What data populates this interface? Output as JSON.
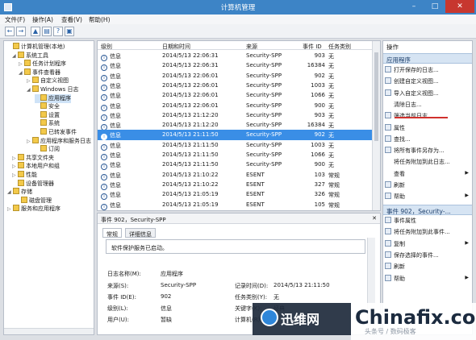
{
  "window": {
    "title": "计算机管理",
    "min_glyph": "–",
    "max_glyph": "□",
    "close_glyph": "✕"
  },
  "menu": [
    "文件(F)",
    "操作(A)",
    "查看(V)",
    "帮助(H)"
  ],
  "toolbar": [
    "←",
    "→",
    "▲",
    "▤",
    "?",
    "▣"
  ],
  "tree": [
    {
      "label": "计算机管理(本地)",
      "arrow": "",
      "icon": "computer-icon"
    },
    {
      "label": "系统工具",
      "arrow": "◢",
      "icon": "tools-icon"
    },
    {
      "label": "任务计划程序",
      "arrow": "▷",
      "icon": "clock-icon"
    },
    {
      "label": "事件查看器",
      "arrow": "◢",
      "icon": "event-viewer-icon"
    },
    {
      "label": "自定义视图",
      "arrow": "▷",
      "icon": "folder-icon"
    },
    {
      "label": "Windows 日志",
      "arrow": "◢",
      "icon": "folder-icon"
    },
    {
      "label": "应用程序",
      "arrow": "",
      "icon": "log-icon"
    },
    {
      "label": "安全",
      "arrow": "",
      "icon": "log-icon"
    },
    {
      "label": "设置",
      "arrow": "",
      "icon": "log-icon"
    },
    {
      "label": "系统",
      "arrow": "",
      "icon": "log-icon"
    },
    {
      "label": "已转发事件",
      "arrow": "",
      "icon": "log-icon"
    },
    {
      "label": "应用程序和服务日志",
      "arrow": "▷",
      "icon": "folder-icon"
    },
    {
      "label": "订阅",
      "arrow": "",
      "icon": "log-icon"
    },
    {
      "label": "共享文件夹",
      "arrow": "▷",
      "icon": "share-icon"
    },
    {
      "label": "本地用户和组",
      "arrow": "▷",
      "icon": "users-icon"
    },
    {
      "label": "性能",
      "arrow": "▷",
      "icon": "performance-icon"
    },
    {
      "label": "设备管理器",
      "arrow": "",
      "icon": "device-icon"
    },
    {
      "label": "存储",
      "arrow": "◢",
      "icon": "storage-icon"
    },
    {
      "label": "磁盘管理",
      "arrow": "",
      "icon": "disk-icon"
    },
    {
      "label": "服务和应用程序",
      "arrow": "▷",
      "icon": "services-icon"
    }
  ],
  "columns": [
    "级别",
    "日期和时间",
    "来源",
    "事件 ID",
    "任务类别"
  ],
  "events": [
    {
      "level": "信息",
      "datetime": "2014/5/13 22:06:31",
      "source": "Security-SPP",
      "id": "903",
      "category": "无"
    },
    {
      "level": "信息",
      "datetime": "2014/5/13 22:06:31",
      "source": "Security-SPP",
      "id": "16384",
      "category": "无"
    },
    {
      "level": "信息",
      "datetime": "2014/5/13 22:06:01",
      "source": "Security-SPP",
      "id": "902",
      "category": "无"
    },
    {
      "level": "信息",
      "datetime": "2014/5/13 22:06:01",
      "source": "Security-SPP",
      "id": "1003",
      "category": "无"
    },
    {
      "level": "信息",
      "datetime": "2014/5/13 22:06:01",
      "source": "Security-SPP",
      "id": "1066",
      "category": "无"
    },
    {
      "level": "信息",
      "datetime": "2014/5/13 22:06:01",
      "source": "Security-SPP",
      "id": "900",
      "category": "无"
    },
    {
      "level": "信息",
      "datetime": "2014/5/13 21:12:20",
      "source": "Security-SPP",
      "id": "903",
      "category": "无"
    },
    {
      "level": "信息",
      "datetime": "2014/5/13 21:12:20",
      "source": "Security-SPP",
      "id": "16384",
      "category": "无"
    },
    {
      "level": "信息",
      "datetime": "2014/5/13 21:11:50",
      "source": "Security-SPP",
      "id": "902",
      "category": "无"
    },
    {
      "level": "信息",
      "datetime": "2014/5/13 21:11:50",
      "source": "Security-SPP",
      "id": "1003",
      "category": "无"
    },
    {
      "level": "信息",
      "datetime": "2014/5/13 21:11:50",
      "source": "Security-SPP",
      "id": "1066",
      "category": "无"
    },
    {
      "level": "信息",
      "datetime": "2014/5/13 21:11:50",
      "source": "Security-SPP",
      "id": "900",
      "category": "无"
    },
    {
      "level": "信息",
      "datetime": "2014/5/13 21:10:22",
      "source": "ESENT",
      "id": "103",
      "category": "常规"
    },
    {
      "level": "信息",
      "datetime": "2014/5/13 21:10:22",
      "source": "ESENT",
      "id": "327",
      "category": "常规"
    },
    {
      "level": "信息",
      "datetime": "2014/5/13 21:05:19",
      "source": "ESENT",
      "id": "326",
      "category": "常规"
    },
    {
      "level": "信息",
      "datetime": "2014/5/13 21:05:19",
      "source": "ESENT",
      "id": "105",
      "category": "常规"
    }
  ],
  "selected_event_index": 8,
  "detail": {
    "header": "事件 902，Security-SPP",
    "close_glyph": "✕",
    "tabs": [
      "常规",
      "详细信息"
    ],
    "description": "软件保护服务已启动。",
    "fields": [
      {
        "label": "日志名称(M):",
        "value": "应用程序"
      },
      {
        "label": "来源(S):",
        "value": "Security-SPP"
      },
      {
        "label": "记录时间(D):",
        "value": "2014/5/13 21:11:50"
      },
      {
        "label": "事件 ID(E):",
        "value": "902"
      },
      {
        "label": "任务类别(Y):",
        "value": "无"
      },
      {
        "label": "级别(L):",
        "value": "信息"
      },
      {
        "label": "关键字(K):",
        "value": "经典"
      },
      {
        "label": "用户(U):",
        "value": "暂缺"
      },
      {
        "label": "计算机(R):",
        "value": ""
      }
    ]
  },
  "actions": {
    "title": "操作",
    "section1": "应用程序",
    "items1": [
      {
        "label": "打开保存的日志...",
        "icon": "open-log-icon",
        "sub": false
      },
      {
        "label": "创建自定义视图...",
        "icon": "create-view-icon",
        "sub": false
      },
      {
        "label": "导入自定义视图...",
        "icon": "import-icon",
        "sub": false
      },
      {
        "label": "清除日志...",
        "icon": "",
        "sub": false
      },
      {
        "label": "筛选当前日志...",
        "icon": "filter-icon",
        "sub": false
      },
      {
        "label": "属性",
        "icon": "properties-icon",
        "sub": false
      },
      {
        "label": "查找...",
        "icon": "find-icon",
        "sub": false
      },
      {
        "label": "将所有事件另存为...",
        "icon": "save-icon",
        "sub": false
      },
      {
        "label": "将任务附加到此日志...",
        "icon": "",
        "sub": false
      },
      {
        "label": "查看",
        "icon": "",
        "sub": true
      },
      {
        "label": "刷新",
        "icon": "refresh-icon",
        "sub": false
      },
      {
        "label": "帮助",
        "icon": "help-icon",
        "sub": true
      }
    ],
    "section2": "事件 902，Security-...",
    "items2": [
      {
        "label": "事件属性",
        "icon": "event-properties-icon",
        "sub": false
      },
      {
        "label": "将任务附加到此事件...",
        "icon": "attach-task-icon",
        "sub": false
      },
      {
        "label": "复制",
        "icon": "copy-icon",
        "sub": true
      },
      {
        "label": "保存选择的事件...",
        "icon": "save-icon",
        "sub": false
      },
      {
        "label": "刷新",
        "icon": "refresh-icon",
        "sub": false
      },
      {
        "label": "帮助",
        "icon": "help-icon",
        "sub": true
      }
    ],
    "underline_color": "#d0312d"
  },
  "watermark": {
    "brand_cn": "迅维网",
    "brand_en": "Chinafix.com",
    "caption": "头条号 / 数码极客"
  }
}
